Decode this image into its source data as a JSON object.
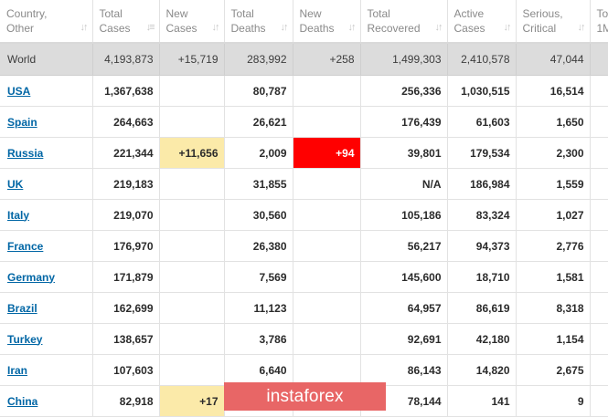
{
  "columns": [
    {
      "line1": "Country,",
      "line2": "Other",
      "sort_icon": "sort-arrows-icon"
    },
    {
      "line1": "Total",
      "line2": "Cases",
      "sort_icon": "sort-desc-icon"
    },
    {
      "line1": "New",
      "line2": "Cases",
      "sort_icon": "sort-arrows-icon"
    },
    {
      "line1": "Total",
      "line2": "Deaths",
      "sort_icon": "sort-arrows-icon"
    },
    {
      "line1": "New",
      "line2": "Deaths",
      "sort_icon": "sort-arrows-icon"
    },
    {
      "line1": "Total",
      "line2": "Recovered",
      "sort_icon": "sort-arrows-icon"
    },
    {
      "line1": "Active",
      "line2": "Cases",
      "sort_icon": "sort-arrows-icon"
    },
    {
      "line1": "Serious,",
      "line2": "Critical",
      "sort_icon": "sort-arrows-icon"
    },
    {
      "line1": "To",
      "line2": "1M",
      "sort_icon": ""
    }
  ],
  "world": {
    "name": "World",
    "total_cases": "4,193,873",
    "new_cases": "+15,719",
    "total_deaths": "283,992",
    "new_deaths": "+258",
    "total_recovered": "1,499,303",
    "active_cases": "2,410,578",
    "serious_critical": "47,044"
  },
  "rows": [
    {
      "name": "USA",
      "total_cases": "1,367,638",
      "new_cases": "",
      "total_deaths": "80,787",
      "new_deaths": "",
      "total_recovered": "256,336",
      "active_cases": "1,030,515",
      "serious_critical": "16,514"
    },
    {
      "name": "Spain",
      "total_cases": "264,663",
      "new_cases": "",
      "total_deaths": "26,621",
      "new_deaths": "",
      "total_recovered": "176,439",
      "active_cases": "61,603",
      "serious_critical": "1,650"
    },
    {
      "name": "Russia",
      "total_cases": "221,344",
      "new_cases": "+11,656",
      "total_deaths": "2,009",
      "new_deaths": "+94",
      "total_recovered": "39,801",
      "active_cases": "179,534",
      "serious_critical": "2,300"
    },
    {
      "name": "UK",
      "total_cases": "219,183",
      "new_cases": "",
      "total_deaths": "31,855",
      "new_deaths": "",
      "total_recovered": "N/A",
      "active_cases": "186,984",
      "serious_critical": "1,559"
    },
    {
      "name": "Italy",
      "total_cases": "219,070",
      "new_cases": "",
      "total_deaths": "30,560",
      "new_deaths": "",
      "total_recovered": "105,186",
      "active_cases": "83,324",
      "serious_critical": "1,027"
    },
    {
      "name": "France",
      "total_cases": "176,970",
      "new_cases": "",
      "total_deaths": "26,380",
      "new_deaths": "",
      "total_recovered": "56,217",
      "active_cases": "94,373",
      "serious_critical": "2,776"
    },
    {
      "name": "Germany",
      "total_cases": "171,879",
      "new_cases": "",
      "total_deaths": "7,569",
      "new_deaths": "",
      "total_recovered": "145,600",
      "active_cases": "18,710",
      "serious_critical": "1,581"
    },
    {
      "name": "Brazil",
      "total_cases": "162,699",
      "new_cases": "",
      "total_deaths": "11,123",
      "new_deaths": "",
      "total_recovered": "64,957",
      "active_cases": "86,619",
      "serious_critical": "8,318"
    },
    {
      "name": "Turkey",
      "total_cases": "138,657",
      "new_cases": "",
      "total_deaths": "3,786",
      "new_deaths": "",
      "total_recovered": "92,691",
      "active_cases": "42,180",
      "serious_critical": "1,154"
    },
    {
      "name": "Iran",
      "total_cases": "107,603",
      "new_cases": "",
      "total_deaths": "6,640",
      "new_deaths": "",
      "total_recovered": "86,143",
      "active_cases": "14,820",
      "serious_critical": "2,675"
    },
    {
      "name": "China",
      "total_cases": "82,918",
      "new_cases": "+17",
      "total_deaths": "",
      "new_deaths": "",
      "total_recovered": "78,144",
      "active_cases": "141",
      "serious_critical": "9"
    }
  ],
  "highlights": {
    "new_cases_color": "#fbeaa9",
    "new_deaths_color": "#ff0000",
    "world_row_color": "#dcdcdc",
    "link_color": "#0066a5"
  },
  "watermark": {
    "text": "instaforex",
    "color": "#e86666"
  }
}
